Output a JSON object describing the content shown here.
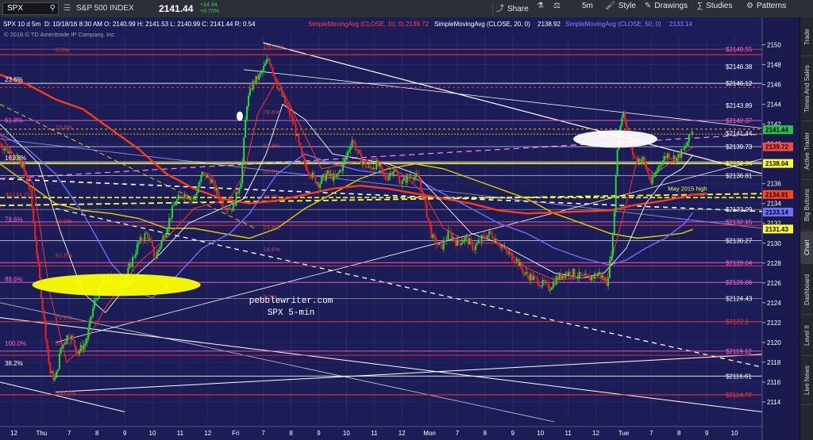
{
  "toolbar": {
    "symbol": "SPX",
    "interval_label": "S&P 500 INDEX",
    "price": "2141.44",
    "change": "+14.94",
    "change_pct": "+0.70%",
    "share_label": "Share",
    "interval_btn": "5m",
    "style_label": "Style",
    "drawings_label": "Drawings",
    "studies_label": "Studies",
    "patterns_label": "Patterns"
  },
  "legend": {
    "header": "SPX 10 d 5m",
    "ohlc": "D: 10/18/16 8:30 AM   O: 2140.99   H: 2141.53   L: 2140.99   C: 2141.44   R: 0.54",
    "copyright": "© 2016 © TD Ameritrade IP Company, Inc.",
    "sma10": "SimpleMovingAvg (CLOSE, 10, 0)",
    "sma10_val": "2139.72",
    "sma20": "SimpleMovingAvg (CLOSE, 20, 0)",
    "sma20_val": "2138.92",
    "sma50": "SimpleMovingAvg (CLOSE, 50, 0)",
    "sma50_val": "2133.14"
  },
  "sidebar": [
    "Trade",
    "Times And Sales",
    "Active Trader",
    "Big Buttons",
    "Chart",
    "Dashboard",
    "Level II",
    "Live News"
  ],
  "chart_data": {
    "type": "candlestick",
    "symbol": "SPX",
    "ylim": [
      2112,
      2151
    ],
    "y_ticks": [
      2114,
      2116,
      2118,
      2120,
      2122,
      2124,
      2126,
      2128,
      2130,
      2132,
      2134,
      2136,
      2138,
      2140,
      2142,
      2144,
      2146,
      2148,
      2150
    ],
    "x_ticks": [
      {
        "label": "12",
        "x": 0.5
      },
      {
        "label": "Thu",
        "x": 1.5
      },
      {
        "label": "7",
        "x": 2.5
      },
      {
        "label": "8",
        "x": 3.5
      },
      {
        "label": "9",
        "x": 4.5
      },
      {
        "label": "10",
        "x": 5.5
      },
      {
        "label": "11",
        "x": 6.5
      },
      {
        "label": "12",
        "x": 7.5
      },
      {
        "label": "Fri",
        "x": 8.5
      },
      {
        "label": "7",
        "x": 9.5
      },
      {
        "label": "8",
        "x": 10.5
      },
      {
        "label": "9",
        "x": 11.5
      },
      {
        "label": "10",
        "x": 12.5
      },
      {
        "label": "11",
        "x": 13.5
      },
      {
        "label": "12",
        "x": 14.5
      },
      {
        "label": "Mon",
        "x": 15.5
      },
      {
        "label": "7",
        "x": 16.5
      },
      {
        "label": "8",
        "x": 17.5
      },
      {
        "label": "9",
        "x": 18.5
      },
      {
        "label": "10",
        "x": 19.5
      },
      {
        "label": "11",
        "x": 20.5
      },
      {
        "label": "12",
        "x": 21.5
      },
      {
        "label": "Tue",
        "x": 22.5
      },
      {
        "label": "7",
        "x": 23.5
      },
      {
        "label": "8",
        "x": 24.5
      },
      {
        "label": "9",
        "x": 25.5
      },
      {
        "label": "10",
        "x": 26.5
      }
    ],
    "x_range": [
      0,
      27.5
    ],
    "price_path": [
      [
        0.0,
        2140.0
      ],
      [
        0.4,
        2139.0
      ],
      [
        0.8,
        2138.0
      ],
      [
        1.1,
        2135.0
      ],
      [
        1.4,
        2127.0
      ],
      [
        1.6,
        2122.0
      ],
      [
        1.8,
        2117.0
      ],
      [
        2.0,
        2116.2
      ],
      [
        2.2,
        2119.5
      ],
      [
        2.5,
        2121.0
      ],
      [
        2.8,
        2119.0
      ],
      [
        3.1,
        2120.0
      ],
      [
        3.4,
        2124.0
      ],
      [
        3.7,
        2126.0
      ],
      [
        4.0,
        2126.5
      ],
      [
        4.3,
        2125.5
      ],
      [
        4.6,
        2127.0
      ],
      [
        5.0,
        2130.0
      ],
      [
        5.3,
        2131.0
      ],
      [
        5.6,
        2128.5
      ],
      [
        6.0,
        2131.5
      ],
      [
        6.3,
        2134.0
      ],
      [
        6.6,
        2135.0
      ],
      [
        7.0,
        2134.5
      ],
      [
        7.3,
        2137.0
      ],
      [
        7.6,
        2136.5
      ],
      [
        8.0,
        2134.0
      ],
      [
        8.4,
        2133.5
      ],
      [
        8.7,
        2136.5
      ],
      [
        8.9,
        2144.0
      ],
      [
        9.1,
        2146.0
      ],
      [
        9.4,
        2147.0
      ],
      [
        9.7,
        2148.7
      ],
      [
        10.0,
        2146.0
      ],
      [
        10.3,
        2144.0
      ],
      [
        10.6,
        2142.0
      ],
      [
        10.9,
        2138.5
      ],
      [
        11.2,
        2137.0
      ],
      [
        11.5,
        2136.0
      ],
      [
        11.8,
        2137.0
      ],
      [
        12.1,
        2136.5
      ],
      [
        12.4,
        2138.0
      ],
      [
        12.7,
        2140.5
      ],
      [
        13.0,
        2138.5
      ],
      [
        13.3,
        2137.5
      ],
      [
        13.6,
        2138.0
      ],
      [
        13.9,
        2136.5
      ],
      [
        14.2,
        2137.5
      ],
      [
        14.5,
        2136.0
      ],
      [
        14.8,
        2137.0
      ],
      [
        15.1,
        2136.5
      ],
      [
        15.4,
        2133.0
      ],
      [
        15.6,
        2130.5
      ],
      [
        15.9,
        2129.5
      ],
      [
        16.2,
        2131.0
      ],
      [
        16.5,
        2130.0
      ],
      [
        16.8,
        2130.5
      ],
      [
        17.1,
        2129.5
      ],
      [
        17.4,
        2130.5
      ],
      [
        17.7,
        2131.0
      ],
      [
        18.0,
        2130.0
      ],
      [
        18.3,
        2129.0
      ],
      [
        18.6,
        2128.5
      ],
      [
        18.9,
        2127.0
      ],
      [
        19.2,
        2126.5
      ],
      [
        19.5,
        2126.0
      ],
      [
        19.8,
        2125.5
      ],
      [
        20.1,
        2126.5
      ],
      [
        20.4,
        2127.0
      ],
      [
        20.7,
        2127.0
      ],
      [
        21.0,
        2126.5
      ],
      [
        21.3,
        2126.5
      ],
      [
        21.6,
        2127.0
      ],
      [
        21.9,
        2126.0
      ],
      [
        22.1,
        2130.0
      ],
      [
        22.3,
        2141.0
      ],
      [
        22.5,
        2143.5
      ],
      [
        22.7,
        2140.0
      ],
      [
        22.9,
        2138.5
      ],
      [
        23.2,
        2138.5
      ],
      [
        23.5,
        2136.0
      ],
      [
        23.8,
        2138.0
      ],
      [
        24.1,
        2139.0
      ],
      [
        24.4,
        2138.5
      ],
      [
        24.7,
        2139.5
      ],
      [
        25.0,
        2141.5
      ]
    ],
    "sma10_path": [
      [
        0.0,
        2141.0
      ],
      [
        1.2,
        2136.0
      ],
      [
        1.8,
        2125.0
      ],
      [
        2.4,
        2118.0
      ],
      [
        3.0,
        2119.5
      ],
      [
        3.8,
        2123.5
      ],
      [
        5.0,
        2128.0
      ],
      [
        6.0,
        2130.5
      ],
      [
        7.0,
        2133.5
      ],
      [
        8.3,
        2134.5
      ],
      [
        8.8,
        2137.0
      ],
      [
        9.3,
        2143.0
      ],
      [
        10.0,
        2146.5
      ],
      [
        10.8,
        2142.0
      ],
      [
        11.6,
        2137.5
      ],
      [
        12.5,
        2138.0
      ],
      [
        13.5,
        2138.5
      ],
      [
        14.5,
        2137.0
      ],
      [
        15.3,
        2135.0
      ],
      [
        16.0,
        2131.5
      ],
      [
        17.0,
        2130.0
      ],
      [
        18.0,
        2130.0
      ],
      [
        19.0,
        2127.5
      ],
      [
        20.0,
        2126.3
      ],
      [
        21.0,
        2126.5
      ],
      [
        21.9,
        2126.5
      ],
      [
        22.5,
        2133.0
      ],
      [
        23.0,
        2138.5
      ],
      [
        23.6,
        2137.0
      ],
      [
        24.3,
        2138.3
      ],
      [
        25.0,
        2139.7
      ]
    ],
    "sma20_path": [
      [
        0.0,
        2142.0
      ],
      [
        1.4,
        2138.0
      ],
      [
        2.2,
        2131.0
      ],
      [
        3.0,
        2125.0
      ],
      [
        3.8,
        2123.0
      ],
      [
        4.8,
        2126.5
      ],
      [
        5.8,
        2129.0
      ],
      [
        6.8,
        2132.0
      ],
      [
        8.0,
        2133.5
      ],
      [
        8.8,
        2134.5
      ],
      [
        9.6,
        2139.0
      ],
      [
        10.2,
        2144.0
      ],
      [
        11.0,
        2142.5
      ],
      [
        12.0,
        2139.0
      ],
      [
        13.0,
        2138.5
      ],
      [
        14.0,
        2138.0
      ],
      [
        15.0,
        2137.0
      ],
      [
        16.0,
        2134.0
      ],
      [
        17.0,
        2131.0
      ],
      [
        18.0,
        2130.0
      ],
      [
        19.0,
        2128.5
      ],
      [
        20.0,
        2127.0
      ],
      [
        21.0,
        2126.5
      ],
      [
        21.8,
        2127.0
      ],
      [
        22.6,
        2129.5
      ],
      [
        23.3,
        2134.0
      ],
      [
        24.0,
        2136.5
      ],
      [
        24.6,
        2137.5
      ],
      [
        25.0,
        2138.9
      ]
    ],
    "sma50_path": [
      [
        0.0,
        2141.0
      ],
      [
        1.0,
        2139.5
      ],
      [
        2.0,
        2137.0
      ],
      [
        3.0,
        2133.0
      ],
      [
        4.0,
        2128.0
      ],
      [
        5.0,
        2125.0
      ],
      [
        5.5,
        2124.5
      ],
      [
        6.3,
        2126.5
      ],
      [
        7.3,
        2129.5
      ],
      [
        8.3,
        2131.0
      ],
      [
        9.0,
        2133.0
      ],
      [
        10.0,
        2137.0
      ],
      [
        11.0,
        2139.0
      ],
      [
        12.0,
        2138.0
      ],
      [
        13.0,
        2137.3
      ],
      [
        14.0,
        2137.0
      ],
      [
        15.0,
        2136.5
      ],
      [
        16.0,
        2135.0
      ],
      [
        17.0,
        2133.5
      ],
      [
        18.0,
        2132.0
      ],
      [
        19.0,
        2131.0
      ],
      [
        20.0,
        2129.5
      ],
      [
        21.0,
        2128.5
      ],
      [
        22.0,
        2127.8
      ],
      [
        22.6,
        2128.3
      ],
      [
        23.3,
        2129.5
      ],
      [
        24.0,
        2130.5
      ],
      [
        24.7,
        2132.0
      ],
      [
        25.0,
        2133.1
      ]
    ],
    "red_ma_path": [
      [
        0.0,
        2147.0
      ],
      [
        1.0,
        2146.0
      ],
      [
        2.0,
        2144.5
      ],
      [
        3.0,
        2143.5
      ],
      [
        4.0,
        2141.5
      ],
      [
        5.0,
        2139.5
      ],
      [
        6.0,
        2137.0
      ],
      [
        7.0,
        2135.5
      ],
      [
        8.0,
        2134.5
      ],
      [
        9.0,
        2134.0
      ],
      [
        10.0,
        2134.3
      ],
      [
        11.0,
        2134.9
      ],
      [
        12.0,
        2135.5
      ],
      [
        13.0,
        2135.8
      ],
      [
        14.0,
        2135.5
      ],
      [
        15.0,
        2135.0
      ],
      [
        16.0,
        2134.5
      ],
      [
        17.0,
        2134.0
      ],
      [
        18.0,
        2133.3
      ],
      [
        19.0,
        2133.0
      ],
      [
        20.0,
        2133.1
      ],
      [
        21.0,
        2133.2
      ],
      [
        22.0,
        2133.3
      ],
      [
        23.0,
        2133.9
      ],
      [
        24.0,
        2134.3
      ],
      [
        25.0,
        2134.9
      ],
      [
        25.5,
        2135.0
      ]
    ],
    "yellow_ma_path": [
      [
        0.0,
        2138.0
      ],
      [
        1.0,
        2136.0
      ],
      [
        2.0,
        2134.0
      ],
      [
        3.0,
        2133.3
      ],
      [
        4.0,
        2133.0
      ],
      [
        5.0,
        2132.5
      ],
      [
        6.0,
        2131.5
      ],
      [
        7.0,
        2131.5
      ],
      [
        8.0,
        2131.0
      ],
      [
        9.0,
        2130.5
      ],
      [
        10.0,
        2131.5
      ],
      [
        11.0,
        2133.5
      ],
      [
        12.0,
        2135.0
      ],
      [
        13.0,
        2136.5
      ],
      [
        14.0,
        2137.5
      ],
      [
        15.0,
        2138.0
      ],
      [
        16.0,
        2137.5
      ],
      [
        17.0,
        2136.5
      ],
      [
        18.0,
        2135.5
      ],
      [
        19.0,
        2134.5
      ],
      [
        20.0,
        2133.0
      ],
      [
        21.0,
        2132.0
      ],
      [
        22.0,
        2131.0
      ],
      [
        23.0,
        2130.5
      ],
      [
        24.0,
        2130.8
      ],
      [
        24.6,
        2131.0
      ],
      [
        25.0,
        2131.4
      ]
    ],
    "fib_lines": [
      {
        "label": "23.6%",
        "price": 2146.12,
        "color": "#ffffff",
        "x_end_label": "$2146.12"
      },
      {
        "label": "61.8%",
        "price": 2142.0,
        "color": "#ff66cc"
      },
      {
        "label": "161.8%",
        "price": 2138.2,
        "color": "#ffffff"
      },
      {
        "label": "78.6%",
        "price": 2132.0,
        "color": "#ff66cc"
      },
      {
        "label": "88.6%",
        "price": 2126.0,
        "color": "#ff66cc"
      },
      {
        "label": "100.0%",
        "price": 2119.5,
        "color": "#ff66cc"
      },
      {
        "label": "38.2%",
        "price": 2117.5,
        "color": "#ffffff"
      }
    ],
    "price_labels": [
      {
        "text": "$2149.55",
        "price": 2149.55,
        "color": "#ff66cc"
      },
      {
        "text": "$2146.38",
        "price": 2147.8,
        "color": "#ffffff"
      },
      {
        "text": "$2146.12",
        "price": 2146.12,
        "color": "#ffffff"
      },
      {
        "text": "$2143.89",
        "price": 2143.89,
        "color": "#ffffff"
      },
      {
        "text": "$2142.37",
        "price": 2142.37,
        "color": "#ff66cc"
      },
      {
        "text": "$2141.44",
        "price": 2141.1,
        "color": "#ffffff"
      },
      {
        "text": "$2139.73",
        "price": 2139.73,
        "color": "#ffffff"
      },
      {
        "text": "$2138.04",
        "price": 2138.04,
        "color": "#ffff33"
      },
      {
        "text": "$2136.81",
        "price": 2136.81,
        "color": "#ffffff"
      },
      {
        "text": "$2133.09",
        "price": 2133.4,
        "color": "#ffffff"
      },
      {
        "text": "$2132.15",
        "price": 2132.15,
        "color": "#ff66cc"
      },
      {
        "text": "$2130.27",
        "price": 2130.27,
        "color": "#ffffff"
      },
      {
        "text": "$2128.04",
        "price": 2128.04,
        "color": "#ff66cc"
      },
      {
        "text": "$2126.06",
        "price": 2126.06,
        "color": "#ff66cc"
      },
      {
        "text": "$2124.43",
        "price": 2124.43,
        "color": "#ffffff"
      },
      {
        "text": "$2122.1",
        "price": 2122.1,
        "color": "#ff3333"
      },
      {
        "text": "$2119.12",
        "price": 2119.12,
        "color": "#ff66cc"
      },
      {
        "text": "$2116.61",
        "price": 2116.61,
        "color": "#ffffff"
      },
      {
        "text": "$2114.72",
        "price": 2114.72,
        "color": "#ff3333"
      }
    ],
    "axis_badges": [
      {
        "text": "2141.44",
        "price": 2141.44,
        "bg": "#2bbf4e",
        "fg": "#000000"
      },
      {
        "text": "2139.72",
        "price": 2139.72,
        "bg": "#ff4444",
        "fg": "#000000"
      },
      {
        "text": "2138.04",
        "price": 2138.04,
        "bg": "#ffff33",
        "fg": "#000000"
      },
      {
        "text": "2134.91",
        "price": 2134.91,
        "bg": "#ff4422",
        "fg": "#000000"
      },
      {
        "text": "2133.14",
        "price": 2133.14,
        "bg": "#6f6fff",
        "fg": "#000000"
      },
      {
        "text": "2131.43",
        "price": 2131.43,
        "bg": "#ffff33",
        "fg": "#000000"
      }
    ],
    "annotations": [
      {
        "text": "pebblewriter.com",
        "x": 10.5,
        "price": 2124.0,
        "color": "#ffffff"
      },
      {
        "text": "SPX 5-min",
        "x": 10.5,
        "price": 2122.8,
        "color": "#ffffff"
      },
      {
        "text": "May 2015 high",
        "x": 24.1,
        "price": 2135.3,
        "color": "#ffff66"
      }
    ],
    "fib_overlay_labels": [
      {
        "text": "100.0%",
        "x": 9.5,
        "price": 2149.6
      },
      {
        "text": "0.0%",
        "x": 2.0,
        "price": 2149.3
      },
      {
        "text": "78.6%",
        "x": 9.5,
        "price": 2143.0
      },
      {
        "text": "61.8%",
        "x": 9.5,
        "price": 2139.6
      },
      {
        "text": "50.0%",
        "x": 9.5,
        "price": 2137.0
      },
      {
        "text": "38.2%",
        "x": 9.5,
        "price": 2134.5
      },
      {
        "text": "23.6%",
        "x": 9.5,
        "price": 2131.4
      },
      {
        "text": "14.6%",
        "x": 9.5,
        "price": 2129.2
      },
      {
        "text": "0.0%",
        "x": 9.5,
        "price": 2124.4
      },
      {
        "text": "23.6%",
        "x": 2.0,
        "price": 2141.5
      },
      {
        "text": "50.0%",
        "x": 2.0,
        "price": 2132.0
      },
      {
        "text": "61.8%",
        "x": 2.0,
        "price": 2128.6
      },
      {
        "text": "78.6%",
        "x": 2.0,
        "price": 2122.3
      },
      {
        "text": "88.6%",
        "x": 2.0,
        "price": 2119.7
      },
      {
        "text": "100.0%",
        "x": 2.0,
        "price": 2114.7
      },
      {
        "text": "$2134.72",
        "x": 0.2,
        "price": 2134.7
      }
    ]
  }
}
